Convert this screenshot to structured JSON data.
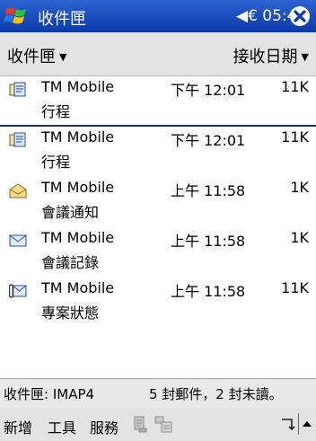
{
  "titlebar": {
    "title": "收件匣",
    "time": "◀€ 05:44"
  },
  "header": {
    "folder_label": "收件匣",
    "sort_label": "接收日期"
  },
  "messages": [
    {
      "sender": "TM Mobile",
      "subject": "行程",
      "time": "下午 12:01",
      "size": "11K",
      "icon": "meeting-request-icon"
    },
    {
      "sender": "TM Mobile",
      "subject": "行程",
      "time": "下午 12:01",
      "size": "11K",
      "icon": "meeting-request-icon"
    },
    {
      "sender": "TM Mobile",
      "subject": "會議通知",
      "time": "上午 11:58",
      "size": "1K",
      "icon": "open-mail-icon"
    },
    {
      "sender": "TM Mobile",
      "subject": "會議記錄",
      "time": "上午 11:58",
      "size": "1K",
      "icon": "mail-icon"
    },
    {
      "sender": "TM Mobile",
      "subject": "專案狀態",
      "time": "上午 11:58",
      "size": "11K",
      "icon": "mail-attachment-icon"
    }
  ],
  "status": {
    "folder_info": "收件匣: IMAP4",
    "count_info": "5 封郵件，2 封未讀。"
  },
  "menubar": {
    "new_label": "新增",
    "tools_label": "工具",
    "services_label": "服務"
  },
  "colors": {
    "titlebar": "#1f4fbf",
    "selection_line": "#1e2d7a"
  }
}
